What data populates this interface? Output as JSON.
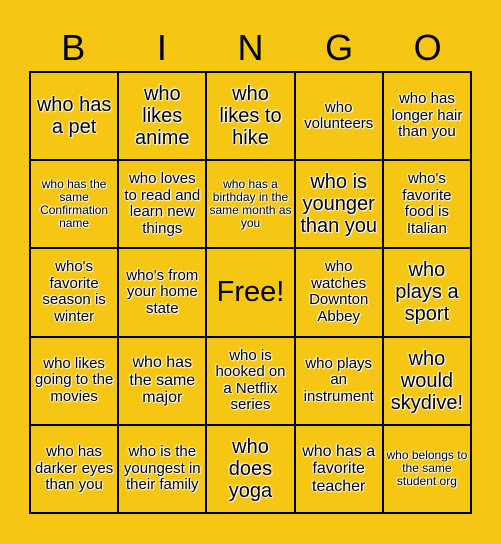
{
  "header": {
    "letters": [
      "B",
      "I",
      "N",
      "G",
      "O"
    ]
  },
  "colors": {
    "background": "#F5C714",
    "grid_line": "#000000"
  },
  "cells": [
    "who has a pet",
    "who likes anime",
    "who likes to hike",
    "who volunteers",
    "who has longer hair than you",
    "who has the same Confirmation name",
    "who loves to read and learn new things",
    "who has a birthday in the same month as you",
    "who is younger than you",
    "who's favorite food is Italian",
    "who's favorite season is winter",
    "who's from your home state",
    "Free!",
    "who watches Downton Abbey",
    "who plays a sport",
    "who likes going to the movies",
    "who has the same major",
    "who is hooked on a Netflix series",
    "who plays an instrument",
    "who would skydive!",
    "who has darker eyes than you",
    "who is the youngest in their family",
    "who does yoga",
    "who has a favorite teacher",
    "who belongs to the same student org"
  ]
}
